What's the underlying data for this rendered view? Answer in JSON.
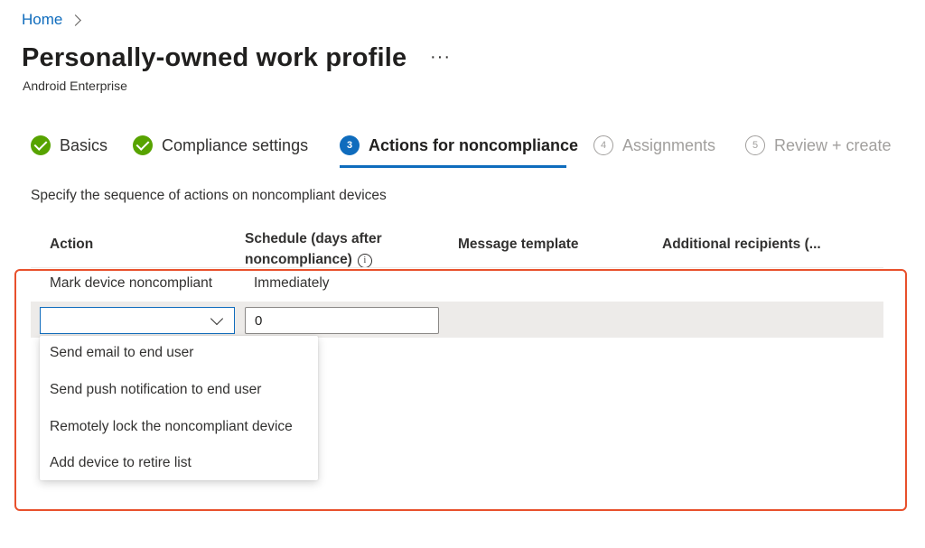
{
  "breadcrumb": {
    "home": "Home"
  },
  "page": {
    "title": "Personally-owned work profile",
    "more": "···",
    "subtitle": "Android Enterprise"
  },
  "steps": [
    {
      "label": "Basics",
      "state": "done"
    },
    {
      "label": "Compliance settings",
      "state": "done"
    },
    {
      "label": "Actions for noncompliance",
      "state": "active",
      "number": "3"
    },
    {
      "label": "Assignments",
      "state": "pending",
      "number": "4"
    },
    {
      "label": "Review + create",
      "state": "pending",
      "number": "5"
    }
  ],
  "description": "Specify the sequence of actions on noncompliant devices",
  "table": {
    "columns": {
      "action": "Action",
      "schedule_line1": "Schedule (days after",
      "schedule_line2": "noncompliance)",
      "info_icon": "i",
      "message": "Message template",
      "recipients": "Additional recipients (..."
    },
    "rows": [
      {
        "action": "Mark device noncompliant",
        "schedule": "Immediately"
      }
    ],
    "new_row": {
      "action_value": "",
      "schedule_value": "0"
    }
  },
  "dropdown": {
    "options": [
      "Send email to end user",
      "Send push notification to end user",
      "Remotely lock the noncompliant device",
      "Add device to retire list"
    ]
  },
  "colors": {
    "accent": "#0f6cbd",
    "success": "#57a300",
    "highlight": "#e8502c"
  }
}
